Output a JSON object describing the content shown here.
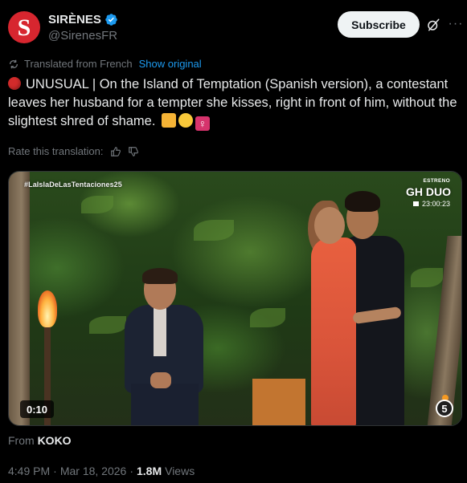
{
  "author": {
    "display_name": "SIRÈNES",
    "handle": "@SirenesFR",
    "avatar_letter": "S",
    "avatar_color": "#d7262f",
    "verified": true
  },
  "actions": {
    "subscribe_label": "Subscribe",
    "more_label": "···"
  },
  "translation": {
    "notice": "Translated from French",
    "show_original": "Show original",
    "rate_label": "Rate this translation:"
  },
  "tweet": {
    "text": "UNUSUAL | On the Island of Temptation (Spanish version), a contestant leaves her husband for a tempter she kisses, right in front of him, without the slightest shred of shame.",
    "emojis": [
      "kiss-emoji",
      "crying-face-emoji",
      "female-sign-emoji"
    ]
  },
  "video": {
    "hashtag": "#LaIslaDeLasTentaciones25",
    "tag_small": "ESTRENO",
    "channel_title": "GH DUO",
    "broadcast_time": "23:00:23",
    "duration": "0:10",
    "channel_logo": "5"
  },
  "source": {
    "prefix": "From",
    "name": "KOKO"
  },
  "meta": {
    "time": "4:49 PM",
    "separator": "·",
    "date": "Mar 18, 2026",
    "views_count": "1.8M",
    "views_label": "Views"
  },
  "colors": {
    "background": "#000000",
    "text_primary": "#e7e9ea",
    "text_secondary": "#71767b",
    "link": "#1d9bf0",
    "verified": "#1d9bf0"
  }
}
